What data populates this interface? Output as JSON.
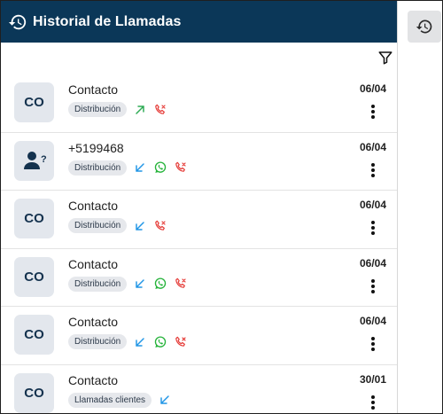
{
  "header": {
    "title": "Historial de Llamadas"
  },
  "colors": {
    "header_bg": "#0b3758",
    "outgoing": "#2eab55",
    "incoming": "#2196e6",
    "missed": "#e53935",
    "whatsapp": "#25b33a"
  },
  "calls": [
    {
      "avatar": "CO",
      "avatar_icon": null,
      "name": "Contacto",
      "tag": "Distribución",
      "date": "06/04",
      "icons": [
        "outgoing-call-icon",
        "missed-call-icon"
      ]
    },
    {
      "avatar": "",
      "avatar_icon": "unknown-person-icon",
      "name": "+5199468",
      "tag": "Distribución",
      "date": "06/04",
      "icons": [
        "incoming-call-icon",
        "whatsapp-icon",
        "missed-call-icon"
      ]
    },
    {
      "avatar": "CO",
      "avatar_icon": null,
      "name": "Contacto",
      "tag": "Distribución",
      "date": "06/04",
      "icons": [
        "incoming-call-icon",
        "missed-call-icon"
      ]
    },
    {
      "avatar": "CO",
      "avatar_icon": null,
      "name": "Contacto",
      "tag": "Distribución",
      "date": "06/04",
      "icons": [
        "incoming-call-icon",
        "whatsapp-icon",
        "missed-call-icon"
      ]
    },
    {
      "avatar": "CO",
      "avatar_icon": null,
      "name": "Contacto",
      "tag": "Distribución",
      "date": "06/04",
      "icons": [
        "incoming-call-icon",
        "whatsapp-icon",
        "missed-call-icon"
      ]
    },
    {
      "avatar": "CO",
      "avatar_icon": null,
      "name": "Contacto",
      "tag": "Llamadas clientes",
      "date": "30/01",
      "icons": [
        "incoming-call-icon"
      ]
    }
  ]
}
